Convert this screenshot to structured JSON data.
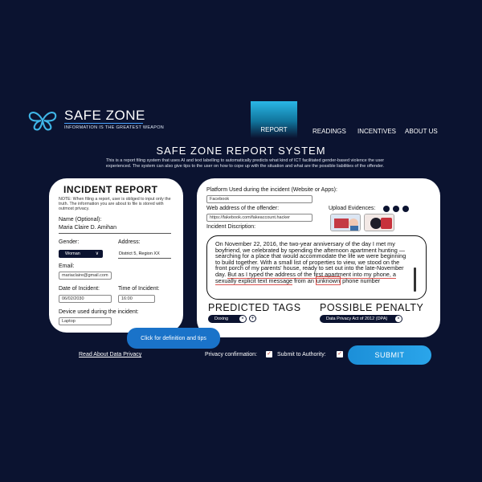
{
  "logo": {
    "title": "SAFE ZONE",
    "tagline": "INFORMATION IS THE GREATEST WEAPON"
  },
  "nav": {
    "active": "REPORT",
    "items": [
      "READINGS",
      "INCENTIVES",
      "ABOUT US"
    ]
  },
  "header": {
    "title": "SAFE ZONE REPORT SYSTEM",
    "description": "This is a report filing system that uses AI and text labelling to automatically predicts what kind of ICT facilitated gender-based violence the user experienced. The system can also give tips to the user on how to cope up with the situation and what are the possible liabilities of the offender."
  },
  "incident_report": {
    "title": "INCIDENT REPORT",
    "note": "NOTE: When filing a report, user is obliged to input only the truth. The information you are about to file is stored with outmost privacy.",
    "name_label": "Name (Optional):",
    "name_value": "Maria Claire D. Amihan",
    "gender_label": "Gender:",
    "gender_value": "Woman",
    "address_label": "Address:",
    "address_value": "District 5, Region XX",
    "email_label": "Email:",
    "email_value": "mariaclaire@gmail.com",
    "date_label": "Date of Incident:",
    "date_value": "06/02/2030",
    "time_label": "Time of Incident:",
    "time_value": "16:00",
    "device_label": "Device used during the incident:",
    "device_value": "Laptop"
  },
  "details": {
    "platform_label": "Platform Used during the incident (Website or Apps):",
    "platform_value": "Facebook",
    "web_label": "Web address of the offender:",
    "web_value": "https://fakebook.com/fakeaccount.hacker",
    "upload_label": "Upload Evidences:",
    "description_label": "Incident Discription:",
    "story": {
      "p1": "On November 22, 2016, the two-year anniversary of the day I met my boyfriend, we celebrated by spending the afternoon apartment hunting — searching for a place that would accommodate the life we were beginning to build together. With a small list of properties to view, we stood on the front porch of my parents' house, ready to set out into the late-November day. ",
      "hl1": "But as I typed the address of the first apartment into my phone, a",
      "sp": " ",
      "hl2": "sexually explicit text message",
      "mid": " from an ",
      "hl3": "unknown",
      "end": " phone number"
    }
  },
  "predicted_tags": {
    "title": "PREDICTED TAGS",
    "tag": "Doxing"
  },
  "possible_penalty": {
    "title": "POSSIBLE PENALTY",
    "penalty": "Data Privacy Act of 2012 (DPA)"
  },
  "tooltip": "Click for definition and tips",
  "bottom": {
    "privacy_link": "Read About Data Privacy",
    "privacy_confirm": "Privacy confirmation:",
    "submit_authority": "Submit to Authority:",
    "submit": "SUBMIT"
  },
  "colors": {
    "background": "#0b1330",
    "accent": "#2aa5ea",
    "card": "#ffffff",
    "highlight": "#d9534f"
  }
}
